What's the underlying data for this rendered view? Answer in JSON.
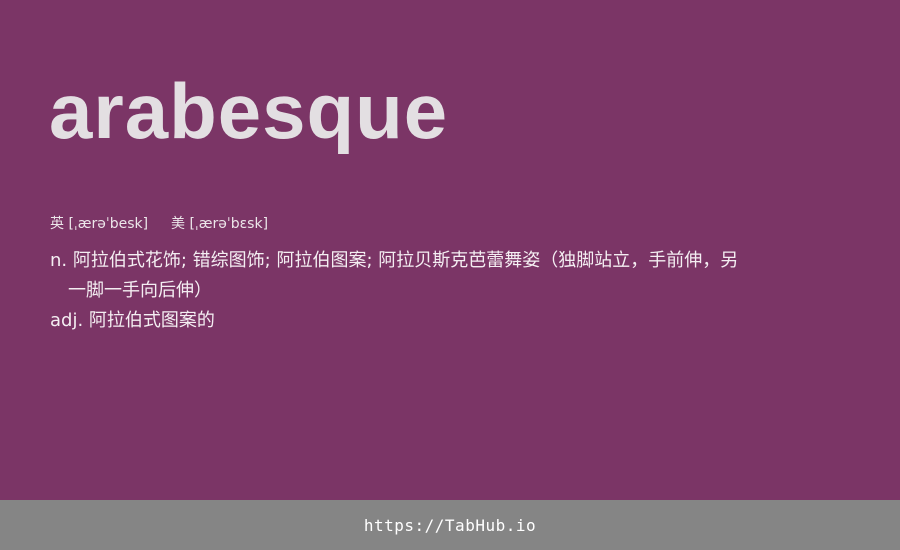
{
  "word": "arabesque",
  "phonetics": {
    "uk_label": "英",
    "uk_ipa": "[ˌærəˈbesk]",
    "us_label": "美",
    "us_ipa": "[ˌærəˈbɛsk]"
  },
  "definitions": [
    {
      "pos": "n.",
      "text": "阿拉伯式花饰; 错综图饰; 阿拉伯图案; 阿拉贝斯克芭蕾舞姿（独脚站立，手前伸，另一脚一手向后伸）"
    },
    {
      "pos": "adj.",
      "text": "阿拉伯式图案的"
    }
  ],
  "footer": {
    "link_text": "https://TabHub.io"
  },
  "colors": {
    "background": "#7b3566",
    "footer_background": "#858585",
    "word_text": "#e3dfe2"
  }
}
